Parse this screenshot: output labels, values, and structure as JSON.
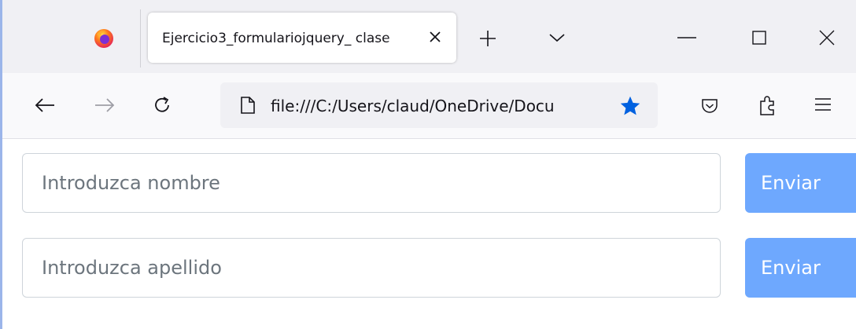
{
  "browser": {
    "tab": {
      "title": "Ejercicio3_formulariojquery_ clase",
      "favicon": "firefox-icon"
    },
    "address": {
      "url": "file:///C:/Users/claud/OneDrive/Docu",
      "page_icon": "document-icon",
      "bookmark_icon": "star-filled-icon"
    },
    "toolbar_icons": [
      "back-icon",
      "forward-icon",
      "reload-icon",
      "pocket-icon",
      "extensions-icon",
      "menu-icon"
    ],
    "window_controls": [
      "minimize-icon",
      "maximize-icon",
      "close-icon"
    ]
  },
  "form": {
    "rows": [
      {
        "placeholder": "Introduzca nombre",
        "value": "",
        "button_label": "Enviar"
      },
      {
        "placeholder": "Introduzca apellido",
        "value": "",
        "button_label": "Enviar"
      }
    ]
  },
  "colors": {
    "button_bg": "#6ea8fe",
    "bookmark_star": "#0061e0",
    "window_border": "#9bb5ea"
  }
}
